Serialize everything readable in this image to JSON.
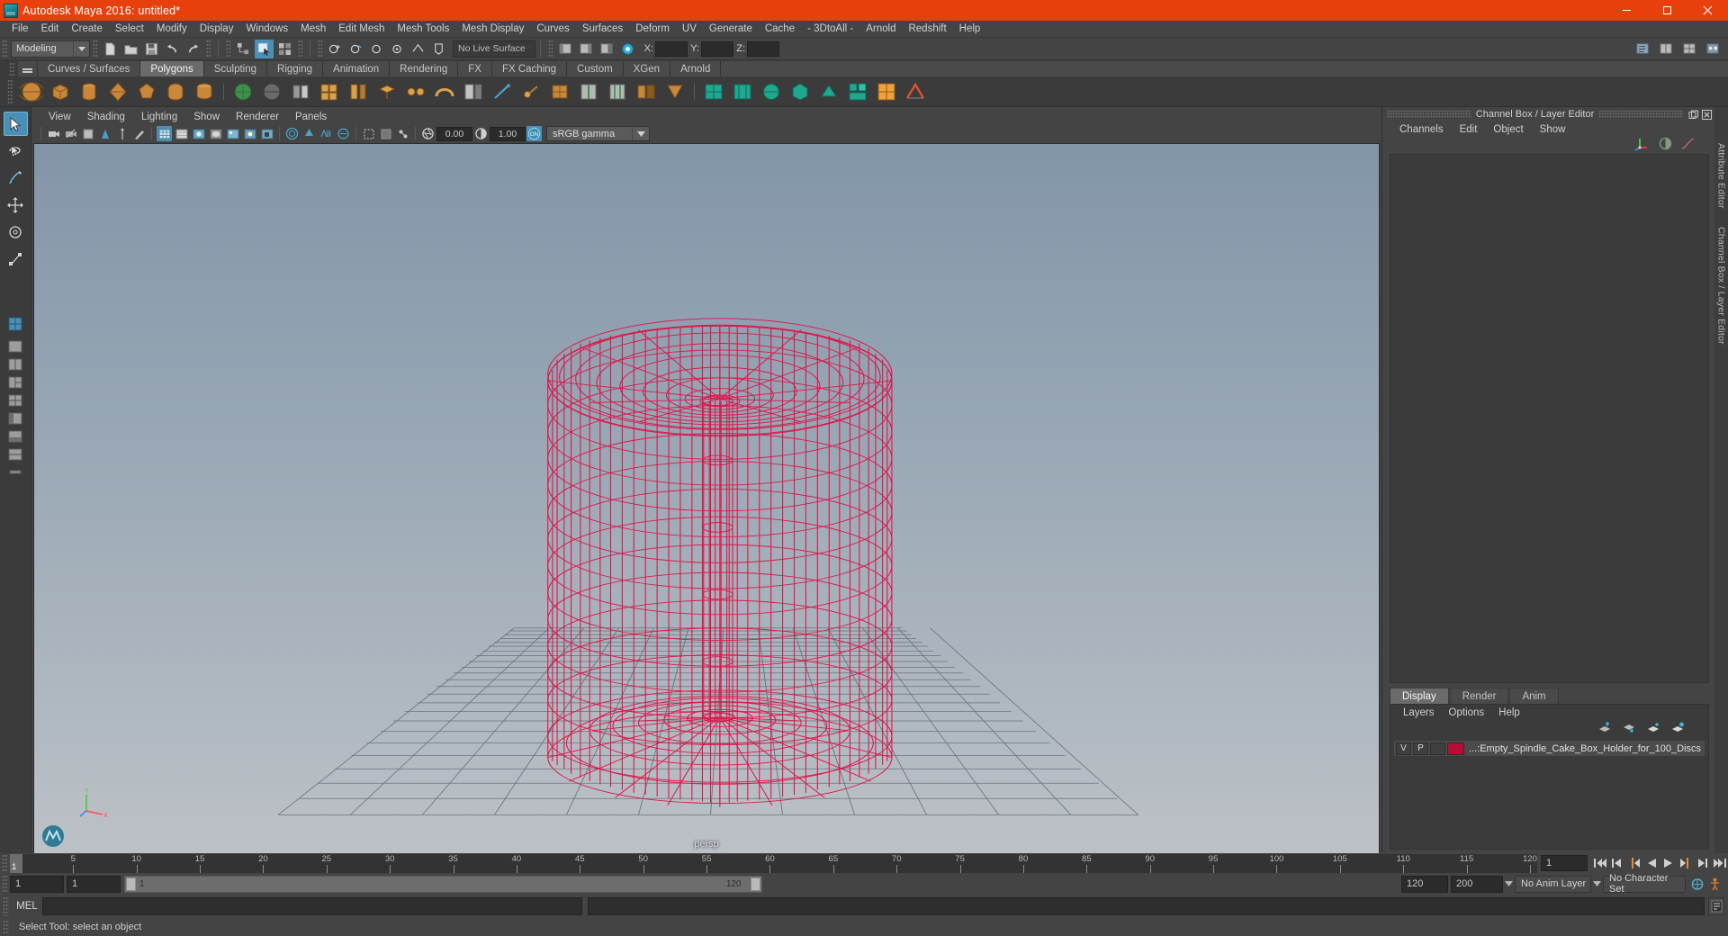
{
  "window": {
    "title": "Autodesk Maya 2016: untitled*",
    "title_bar_color": "#e8400c",
    "minimize_label": "–",
    "maximize_label": "❐",
    "close_label": "✕"
  },
  "menubar": {
    "items": [
      "File",
      "Edit",
      "Create",
      "Select",
      "Modify",
      "Display",
      "Windows",
      "Mesh",
      "Edit Mesh",
      "Mesh Tools",
      "Mesh Display",
      "Curves",
      "Surfaces",
      "Deform",
      "UV",
      "Generate",
      "Cache",
      "- 3DtoAll -",
      "Arnold",
      "Redshift",
      "Help"
    ]
  },
  "statusline": {
    "mode": "Modeling",
    "live_surface": "No Live Surface",
    "coords": [
      {
        "label": "X:",
        "value": ""
      },
      {
        "label": "Y:",
        "value": ""
      },
      {
        "label": "Z:",
        "value": ""
      }
    ]
  },
  "shelf": {
    "tabs": [
      "Curves / Surfaces",
      "Polygons",
      "Sculpting",
      "Rigging",
      "Animation",
      "Rendering",
      "FX",
      "FX Caching",
      "Custom",
      "XGen",
      "Arnold"
    ],
    "active_tab": "Polygons"
  },
  "viewport": {
    "menus": [
      "View",
      "Shading",
      "Lighting",
      "Show",
      "Renderer",
      "Panels"
    ],
    "exposure_value": "0.00",
    "gamma_value": "1.00",
    "color_management_toggle": "ON",
    "color_space": "sRGB gamma",
    "camera_label": "persp",
    "axis_labels": {
      "y": "Y",
      "x": "X",
      "z": "Z"
    },
    "background_top": "#8295a8",
    "background_bottom": "#b6bcc2",
    "wireframe_color": "#e01045",
    "grid_color": "#59636c"
  },
  "channel_box": {
    "panel_title": "Channel Box / Layer Editor",
    "menus": [
      "Channels",
      "Edit",
      "Object",
      "Show"
    ]
  },
  "layer_editor": {
    "tabs": [
      "Display",
      "Render",
      "Anim"
    ],
    "active_tab": "Display",
    "menus": [
      "Layers",
      "Options",
      "Help"
    ],
    "layers": [
      {
        "visibility": "V",
        "playback": "P",
        "state": "",
        "color": "#b80c32",
        "name": "...:Empty_Spindle_Cake_Box_Holder_for_100_Discs"
      }
    ]
  },
  "docked_tabs": {
    "items": [
      "Attribute Editor",
      "Channel Box / Layer Editor"
    ]
  },
  "timeline": {
    "ticks": [
      5,
      10,
      15,
      20,
      25,
      30,
      35,
      40,
      45,
      50,
      55,
      60,
      65,
      70,
      75,
      80,
      85,
      90,
      95,
      100,
      105,
      110,
      115,
      120
    ],
    "start": 1,
    "end": 120,
    "current_frame": "1",
    "current_frame_label": "1",
    "playback_buttons": [
      "go-to-start",
      "step-back-key",
      "step-back-frame",
      "play-backwards",
      "play-forwards",
      "step-forward-frame",
      "step-forward-key",
      "go-to-end"
    ]
  },
  "range_slider": {
    "anim_start": "1",
    "range_start": "1",
    "slider_min_label": "1",
    "slider_max_label": "120",
    "range_end": "120",
    "anim_end": "200",
    "anim_layer": "No Anim Layer",
    "character_set": "No Character Set"
  },
  "command_line": {
    "language_label": "MEL",
    "input_value": "",
    "output_value": ""
  },
  "help_line": {
    "text": "Select Tool: select an object"
  }
}
